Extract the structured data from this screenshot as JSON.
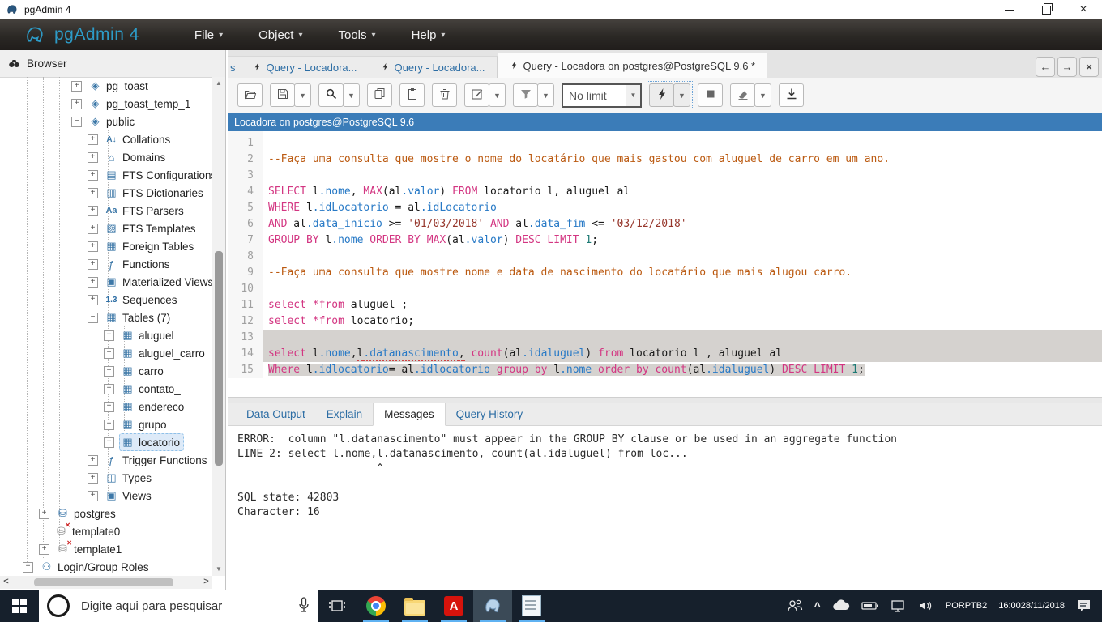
{
  "window": {
    "title": "pgAdmin 4"
  },
  "menubar": {
    "brand": "pgAdmin 4",
    "items": [
      {
        "label": "File"
      },
      {
        "label": "Object"
      },
      {
        "label": "Tools"
      },
      {
        "label": "Help"
      }
    ]
  },
  "colors": {
    "connection_bar": "#3b7cb8",
    "keyword": "#d33682",
    "identifier": "#2779c6",
    "comment": "#bb5a11",
    "string": "#96362b",
    "selection": "#d5d2cf",
    "taskbar": "#16202c",
    "running_indicator": "#5fb2f2"
  },
  "browser": {
    "header": "Browser",
    "tree": [
      {
        "label": "pg_toast",
        "level": 3,
        "expander": "+",
        "icon": "schema"
      },
      {
        "label": "pg_toast_temp_1",
        "level": 3,
        "expander": "+",
        "icon": "schema"
      },
      {
        "label": "public",
        "level": 3,
        "expander": "-",
        "icon": "schema"
      },
      {
        "label": "Collations",
        "level": 4,
        "expander": "+",
        "icon": "collation"
      },
      {
        "label": "Domains",
        "level": 4,
        "expander": "+",
        "icon": "domain"
      },
      {
        "label": "FTS Configurations",
        "level": 4,
        "expander": "+",
        "icon": "fts-config"
      },
      {
        "label": "FTS Dictionaries",
        "level": 4,
        "expander": "+",
        "icon": "fts-dictionary"
      },
      {
        "label": "FTS Parsers",
        "level": 4,
        "expander": "+",
        "icon": "fts-parser"
      },
      {
        "label": "FTS Templates",
        "level": 4,
        "expander": "+",
        "icon": "fts-template"
      },
      {
        "label": "Foreign Tables",
        "level": 4,
        "expander": "+",
        "icon": "foreign-table"
      },
      {
        "label": "Functions",
        "level": 4,
        "expander": "+",
        "icon": "function"
      },
      {
        "label": "Materialized Views",
        "level": 4,
        "expander": "+",
        "icon": "mat-view"
      },
      {
        "label": "Sequences",
        "level": 4,
        "expander": "+",
        "icon": "sequence"
      },
      {
        "label": "Tables (7)",
        "level": 4,
        "expander": "-",
        "icon": "table"
      },
      {
        "label": "aluguel",
        "level": 5,
        "expander": "+",
        "icon": "table"
      },
      {
        "label": "aluguel_carro",
        "level": 5,
        "expander": "+",
        "icon": "table"
      },
      {
        "label": "carro",
        "level": 5,
        "expander": "+",
        "icon": "table"
      },
      {
        "label": "contato_",
        "level": 5,
        "expander": "+",
        "icon": "table"
      },
      {
        "label": "endereco",
        "level": 5,
        "expander": "+",
        "icon": "table"
      },
      {
        "label": "grupo",
        "level": 5,
        "expander": "+",
        "icon": "table"
      },
      {
        "label": "locatorio",
        "level": 5,
        "expander": "+",
        "icon": "table",
        "selected": true
      },
      {
        "label": "Trigger Functions",
        "level": 4,
        "expander": "+",
        "icon": "trigger-function"
      },
      {
        "label": "Types",
        "level": 4,
        "expander": "+",
        "icon": "type"
      },
      {
        "label": "Views",
        "level": 4,
        "expander": "+",
        "icon": "view"
      },
      {
        "label": "postgres",
        "level": 1,
        "expander": "+",
        "icon": "database"
      },
      {
        "label": "template0",
        "level": 1,
        "expander": null,
        "icon": "database-x"
      },
      {
        "label": "template1",
        "level": 1,
        "expander": "+",
        "icon": "database-x"
      },
      {
        "label": "Login/Group Roles",
        "level": 0,
        "expander": "+",
        "icon": "roles"
      }
    ]
  },
  "tabs": {
    "partial": "s",
    "items": [
      {
        "label": "Query - Locadora...",
        "active": false
      },
      {
        "label": "Query - Locadora...",
        "active": false
      },
      {
        "label": "Query - Locadora on postgres@PostgreSQL 9.6 *",
        "active": true
      }
    ]
  },
  "toolbar": {
    "items": [
      {
        "name": "open-file",
        "icon": "folder-open"
      },
      {
        "name": "save",
        "icon": "save",
        "dropdown": true
      },
      {
        "name": "find",
        "icon": "search",
        "dropdown": true
      },
      {
        "name": "copy",
        "icon": "copy"
      },
      {
        "name": "paste",
        "icon": "paste"
      },
      {
        "name": "delete",
        "icon": "trash"
      },
      {
        "name": "edit",
        "icon": "edit",
        "dropdown": true
      },
      {
        "name": "filter",
        "icon": "filter",
        "dropdown": true
      },
      {
        "name": "row-limit",
        "type": "combo",
        "value": "No limit"
      },
      {
        "name": "execute",
        "icon": "bolt",
        "dropdown": true,
        "focused": true
      },
      {
        "name": "stop",
        "icon": "stop"
      },
      {
        "name": "clear",
        "icon": "eraser",
        "dropdown": true
      },
      {
        "name": "download",
        "icon": "download"
      }
    ]
  },
  "connection": {
    "label": "Locadora on postgres@PostgreSQL 9.6"
  },
  "editor": {
    "lines": [
      {
        "tokens": []
      },
      {
        "tokens": [
          [
            "c",
            "--Faça uma consulta que mostre o nome do locatário que mais gastou com aluguel de carro em um ano."
          ]
        ]
      },
      {
        "tokens": []
      },
      {
        "tokens": [
          [
            "k",
            "SELECT"
          ],
          [
            "t",
            " l"
          ],
          [
            "p",
            ".nome"
          ],
          [
            "t",
            ", "
          ],
          [
            "k",
            "MAX"
          ],
          [
            "t",
            "(al"
          ],
          [
            "p",
            ".valor"
          ],
          [
            "t",
            ") "
          ],
          [
            "k",
            "FROM"
          ],
          [
            "t",
            " locatorio l, aluguel al"
          ]
        ]
      },
      {
        "tokens": [
          [
            "k",
            "WHERE"
          ],
          [
            "t",
            " l"
          ],
          [
            "p",
            ".idLocatorio"
          ],
          [
            "t",
            " = al"
          ],
          [
            "p",
            ".idLocatorio"
          ]
        ]
      },
      {
        "tokens": [
          [
            "k",
            "AND"
          ],
          [
            "t",
            " al"
          ],
          [
            "p",
            ".data_inicio"
          ],
          [
            "t",
            " >= "
          ],
          [
            "s",
            "'01/03/2018'"
          ],
          [
            "t",
            " "
          ],
          [
            "k",
            "AND"
          ],
          [
            "t",
            " al"
          ],
          [
            "p",
            ".data_fim"
          ],
          [
            "t",
            " <= "
          ],
          [
            "s",
            "'03/12/2018'"
          ]
        ]
      },
      {
        "tokens": [
          [
            "k",
            "GROUP BY"
          ],
          [
            "t",
            " l"
          ],
          [
            "p",
            ".nome"
          ],
          [
            "t",
            " "
          ],
          [
            "k",
            "ORDER BY"
          ],
          [
            "t",
            " "
          ],
          [
            "k",
            "MAX"
          ],
          [
            "t",
            "(al"
          ],
          [
            "p",
            ".valor"
          ],
          [
            "t",
            ") "
          ],
          [
            "k",
            "DESC LIMIT"
          ],
          [
            "t",
            " "
          ],
          [
            "n",
            "1"
          ],
          [
            "t",
            ";"
          ]
        ]
      },
      {
        "tokens": []
      },
      {
        "tokens": [
          [
            "c",
            "--Faça uma consulta que mostre nome e data de nascimento do locatário que mais alugou carro."
          ]
        ]
      },
      {
        "tokens": []
      },
      {
        "tokens": [
          [
            "k",
            "select"
          ],
          [
            "t",
            " "
          ],
          [
            "k",
            "*from"
          ],
          [
            "t",
            " aluguel ;"
          ]
        ]
      },
      {
        "tokens": [
          [
            "k",
            "select"
          ],
          [
            "t",
            " "
          ],
          [
            "k",
            "*from"
          ],
          [
            "t",
            " locatorio;"
          ]
        ]
      },
      {
        "tokens": [],
        "sel": "full"
      },
      {
        "tokens": [
          [
            "k",
            "select"
          ],
          [
            "t",
            " l"
          ],
          [
            "p",
            ".nome"
          ],
          [
            "t",
            ","
          ],
          [
            "t!",
            "l"
          ],
          [
            "p!",
            ".datanascimento"
          ],
          [
            "t!",
            ","
          ],
          [
            "t",
            " "
          ],
          [
            "k",
            "count"
          ],
          [
            "t",
            "(al"
          ],
          [
            "p",
            ".idaluguel"
          ],
          [
            "t",
            ") "
          ],
          [
            "k",
            "from"
          ],
          [
            "t",
            " locatorio l , aluguel al"
          ]
        ],
        "sel": "full"
      },
      {
        "tokens": [
          [
            "k",
            "Where"
          ],
          [
            "t",
            " l"
          ],
          [
            "p",
            ".idlocatorio"
          ],
          [
            "t",
            "= al"
          ],
          [
            "p",
            ".idlocatorio"
          ],
          [
            "t",
            " "
          ],
          [
            "k",
            "group by"
          ],
          [
            "t",
            " l"
          ],
          [
            "p",
            ".nome"
          ],
          [
            "t",
            " "
          ],
          [
            "k",
            "order by"
          ],
          [
            "t",
            " "
          ],
          [
            "k",
            "count"
          ],
          [
            "t",
            "(al"
          ],
          [
            "p",
            ".idaluguel"
          ],
          [
            "t",
            ") "
          ],
          [
            "k",
            "DESC LIMIT"
          ],
          [
            "t",
            " "
          ],
          [
            "n",
            "1"
          ],
          [
            "t",
            ";"
          ]
        ],
        "sel": "text"
      }
    ]
  },
  "output": {
    "tabs": [
      {
        "label": "Data Output",
        "active": false
      },
      {
        "label": "Explain",
        "active": false
      },
      {
        "label": "Messages",
        "active": true
      },
      {
        "label": "Query History",
        "active": false
      }
    ],
    "messages": [
      "ERROR:  column \"l.datanascimento\" must appear in the GROUP BY clause or be used in an aggregate function",
      "LINE 2: select l.nome,l.datanascimento, count(al.idaluguel) from loc...",
      "                      ^",
      "",
      "SQL state: 42803",
      "Character: 16"
    ]
  },
  "taskbar": {
    "search_placeholder": "Digite aqui para pesquisar",
    "lang_line1": "POR",
    "lang_line2": "PTB2",
    "time": "16:00",
    "date": "28/11/2018"
  }
}
